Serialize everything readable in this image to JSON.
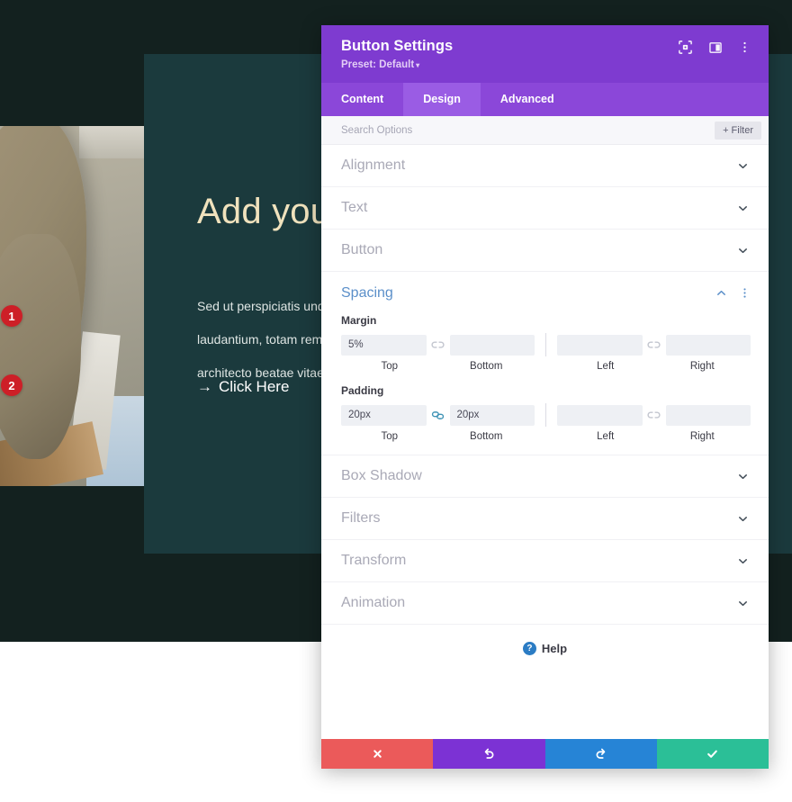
{
  "site": {
    "heading": "Add your",
    "paragraph_lines": [
      "Sed ut perspiciatis und",
      "laudantium, totam rem",
      "architecto beatae vitae"
    ],
    "cta_arrow": "→",
    "cta_label": "Click Here"
  },
  "modal": {
    "title": "Button Settings",
    "preset_label": "Preset: Default",
    "preset_caret": "▾",
    "header_icons": [
      {
        "name": "focus-mode-icon"
      },
      {
        "name": "panel-layout-icon"
      },
      {
        "name": "more-options-icon"
      }
    ],
    "tabs": [
      {
        "label": "Content",
        "active": false
      },
      {
        "label": "Design",
        "active": true
      },
      {
        "label": "Advanced",
        "active": false
      }
    ],
    "search": {
      "placeholder": "Search Options",
      "value": ""
    },
    "filter_button": {
      "plus": "+",
      "label": "Filter"
    },
    "sections_above": [
      {
        "label": "Alignment",
        "expanded": false
      },
      {
        "label": "Text",
        "expanded": false
      },
      {
        "label": "Button",
        "expanded": false
      }
    ],
    "spacing": {
      "title": "Spacing",
      "expanded": true,
      "margin": {
        "group_label": "Margin",
        "link_left_state": "unlinked",
        "link_right_state": "unlinked",
        "fields": [
          {
            "label": "Top",
            "value": "5%"
          },
          {
            "label": "Bottom",
            "value": ""
          },
          {
            "label": "Left",
            "value": ""
          },
          {
            "label": "Right",
            "value": ""
          }
        ]
      },
      "padding": {
        "group_label": "Padding",
        "link_left_state": "linked",
        "link_right_state": "unlinked",
        "fields": [
          {
            "label": "Top",
            "value": "20px"
          },
          {
            "label": "Bottom",
            "value": "20px"
          },
          {
            "label": "Left",
            "value": ""
          },
          {
            "label": "Right",
            "value": ""
          }
        ]
      }
    },
    "sections_below": [
      {
        "label": "Box Shadow",
        "expanded": false
      },
      {
        "label": "Filters",
        "expanded": false
      },
      {
        "label": "Transform",
        "expanded": false
      },
      {
        "label": "Animation",
        "expanded": false
      }
    ],
    "help": {
      "icon_char": "?",
      "label": "Help"
    },
    "footer_buttons": [
      {
        "name": "cancel-button",
        "icon": "close-icon"
      },
      {
        "name": "undo-button",
        "icon": "undo-icon"
      },
      {
        "name": "redo-button",
        "icon": "redo-icon"
      },
      {
        "name": "save-button",
        "icon": "check-icon"
      }
    ]
  },
  "annotations": [
    {
      "number": "1",
      "target": "margin-top-field"
    },
    {
      "number": "2",
      "target": "padding-top-field"
    }
  ],
  "colors": {
    "header_purple": "#7e3bd0",
    "tab_bar_purple": "#8b47d9",
    "tab_active_purple": "#9a5ce4",
    "spacing_blue": "#5b8fc9",
    "badge_red": "#cd1f27",
    "cancel_red": "#eb5a5a",
    "undo_purple": "#7c32d4",
    "redo_blue": "#2684d6",
    "save_teal": "#2bbf97",
    "site_dark": "#13211f",
    "site_panel_teal": "#1b3a3d",
    "site_heading_cream": "#f0e2bd"
  }
}
